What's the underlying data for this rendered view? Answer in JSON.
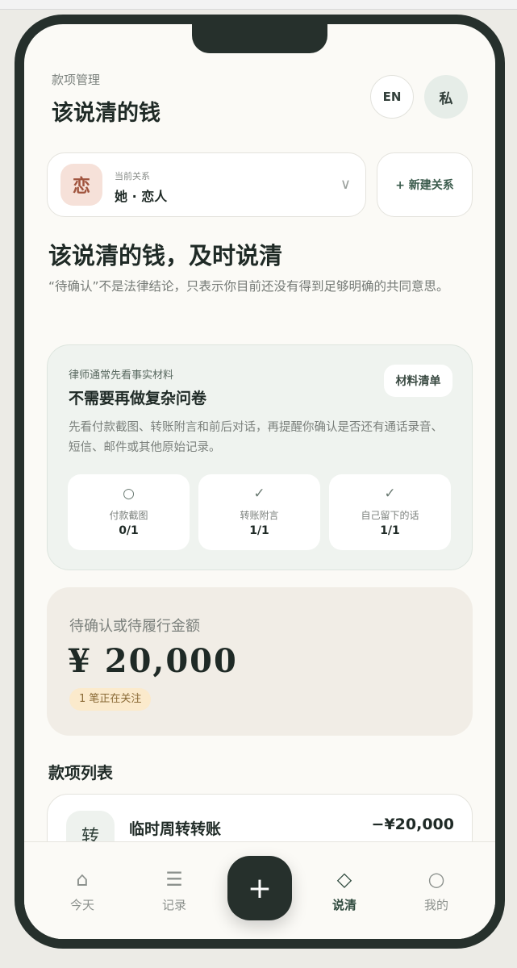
{
  "header": {
    "supertitle": "款项管理",
    "title": "该说清的钱",
    "lang_label": "EN",
    "private_label": "私"
  },
  "relation": {
    "badge": "恋",
    "caption": "当前关系",
    "name": "她 · 恋人",
    "chevron": "∨",
    "new_button": "+  新建关系"
  },
  "hero": {
    "headline": "该说清的钱，及时说清",
    "description": "“待确认”不是法律结论，只表示你目前还没有得到足够明确的共同意思。"
  },
  "lawyer_card": {
    "caption": "律师通常先看事实材料",
    "title": "不需要再做复杂问卷",
    "button": "材料清单",
    "description": "先看付款截图、转账附言和前后对话，再提醒你确认是否还有通话录音、短信、邮件或其他原始记录。",
    "items": [
      {
        "icon": "○",
        "label": "付款截图",
        "value": "0/1"
      },
      {
        "icon": "✓",
        "label": "转账附言",
        "value": "1/1"
      },
      {
        "icon": "✓",
        "label": "自己留下的话",
        "value": "1/1"
      }
    ]
  },
  "amount_card": {
    "caption": "待确认或待履行金额",
    "value": "¥ 20,000",
    "badge": "1 笔正在关注"
  },
  "list": {
    "title": "款项列表",
    "items": [
      {
        "icon": "转",
        "title": "临时周转转账",
        "amount": "−¥20,000"
      }
    ]
  },
  "tabbar": {
    "tabs": [
      {
        "icon": "⌂",
        "label": "今天"
      },
      {
        "icon": "☰",
        "label": "记录"
      },
      {
        "icon": "◇",
        "label": "说清"
      },
      {
        "icon": "○",
        "label": "我的"
      }
    ],
    "fab": "+"
  }
}
